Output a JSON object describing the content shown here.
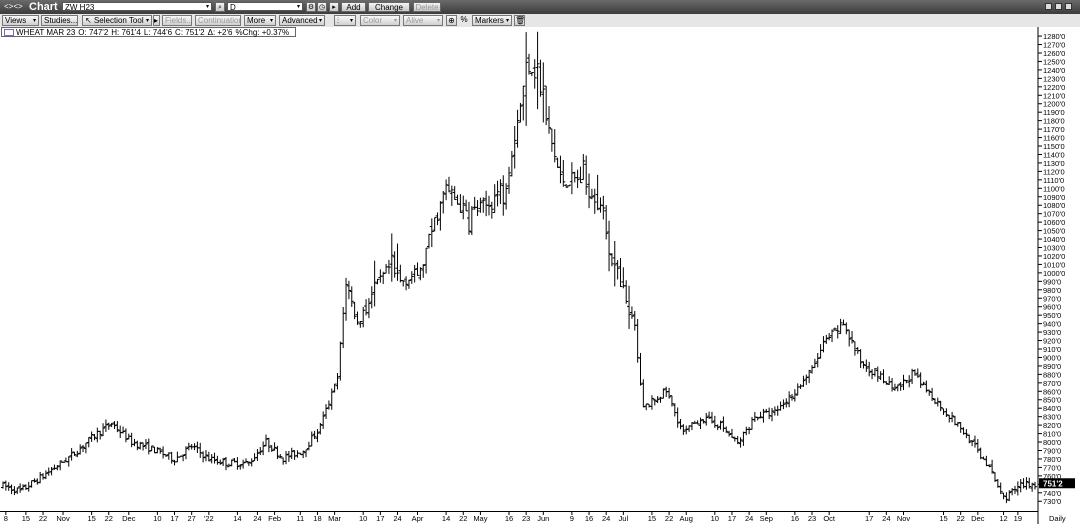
{
  "window": {
    "logo_text": "<><>",
    "title": "Chart",
    "symbol_input": "ZW H23",
    "period_input": "D",
    "add_label": "Add",
    "change_label": "Change",
    "delete_label": "Delete"
  },
  "toolbar": {
    "views": "Views",
    "studies": "Studies...",
    "selection_tool": "Selection Tool",
    "fields": "Fields...",
    "continuation": "Continuation",
    "more": "More",
    "advanced": "Advanced",
    "color": "Color",
    "alive": "Alive",
    "percent": "%",
    "markers": "Markers"
  },
  "legend": {
    "name": "WHEAT MAR 23",
    "open": "O: 747'2",
    "high": "H: 761'4",
    "low": "L: 744'6",
    "close": "C: 751'2",
    "change": "Δ: +2'6",
    "pct": "%Chg: +0.37%"
  },
  "chart_data": {
    "type": "ohlc",
    "ylim": [
      722,
      1286
    ],
    "price_axis_labels": [
      "730'0",
      "740'0",
      "750'0",
      "760'0",
      "770'0",
      "780'0",
      "790'0",
      "800'0",
      "810'0",
      "820'0",
      "830'0",
      "840'0",
      "850'0",
      "860'0",
      "870'0",
      "880'0",
      "890'0",
      "900'0",
      "910'0",
      "920'0",
      "930'0",
      "940'0",
      "950'0",
      "960'0",
      "970'0",
      "980'0",
      "990'0",
      "1000'0",
      "1010'0",
      "1020'0",
      "1030'0",
      "1040'0",
      "1050'0",
      "1060'0",
      "1070'0",
      "1080'0",
      "1090'0",
      "1100'0",
      "1110'0",
      "1120'0",
      "1130'0",
      "1140'0",
      "1150'0",
      "1160'0",
      "1170'0",
      "1180'0",
      "1190'0",
      "1200'0",
      "1210'0",
      "1220'0",
      "1230'0",
      "1240'0",
      "1250'0",
      "1260'0",
      "1270'0",
      "1280'0"
    ],
    "last_price": 751.25,
    "last_price_label": "751'2",
    "period_label": "Daily",
    "x_labels": [
      "8",
      "15",
      "22",
      "Nov",
      "15",
      "22",
      "Dec",
      "10",
      "17",
      "27",
      "'22",
      "14",
      "24",
      "Feb",
      "11",
      "18",
      "Mar",
      "10",
      "17",
      "24",
      "Apr",
      "14",
      "22",
      "May",
      "16",
      "23",
      "Jun",
      "9",
      "16",
      "24",
      "Jul",
      "15",
      "22",
      "Aug",
      "10",
      "17",
      "24",
      "Sep",
      "16",
      "23",
      "Oct",
      "17",
      "24",
      "Nov",
      "15",
      "22",
      "Dec",
      "12",
      "19"
    ],
    "x_label_bars": [
      1,
      8,
      14,
      21,
      31,
      37,
      44,
      54,
      60,
      66,
      72,
      82,
      89,
      95,
      104,
      110,
      116,
      126,
      132,
      138,
      145,
      155,
      161,
      167,
      177,
      183,
      189,
      199,
      205,
      211,
      217,
      227,
      233,
      239,
      249,
      255,
      261,
      267,
      277,
      283,
      289,
      303,
      309,
      315,
      329,
      335,
      341,
      350,
      355
    ],
    "bar_count": 362,
    "key_points": [
      [
        0,
        748
      ],
      [
        6,
        742
      ],
      [
        14,
        760
      ],
      [
        24,
        784
      ],
      [
        32,
        808
      ],
      [
        38,
        822
      ],
      [
        45,
        800
      ],
      [
        52,
        792
      ],
      [
        60,
        780
      ],
      [
        66,
        795
      ],
      [
        72,
        780
      ],
      [
        79,
        775
      ],
      [
        86,
        775
      ],
      [
        92,
        800
      ],
      [
        98,
        781
      ],
      [
        105,
        790
      ],
      [
        111,
        818
      ],
      [
        117,
        875
      ],
      [
        120,
        990
      ],
      [
        124,
        940
      ],
      [
        129,
        975
      ],
      [
        135,
        1005
      ],
      [
        139,
        990
      ],
      [
        146,
        1000
      ],
      [
        150,
        1050
      ],
      [
        155,
        1100
      ],
      [
        162,
        1070
      ],
      [
        170,
        1080
      ],
      [
        176,
        1110
      ],
      [
        181,
        1200
      ],
      [
        184,
        1250
      ],
      [
        187,
        1235
      ],
      [
        190,
        1180
      ],
      [
        195,
        1110
      ],
      [
        202,
        1110
      ],
      [
        209,
        1085
      ],
      [
        214,
        1000
      ],
      [
        221,
        935
      ],
      [
        224,
        840
      ],
      [
        232,
        860
      ],
      [
        238,
        810
      ],
      [
        244,
        828
      ],
      [
        251,
        820
      ],
      [
        257,
        798
      ],
      [
        263,
        830
      ],
      [
        270,
        835
      ],
      [
        277,
        860
      ],
      [
        283,
        885
      ],
      [
        287,
        915
      ],
      [
        294,
        940
      ],
      [
        300,
        895
      ],
      [
        306,
        880
      ],
      [
        312,
        860
      ],
      [
        318,
        880
      ],
      [
        324,
        858
      ],
      [
        330,
        835
      ],
      [
        337,
        808
      ],
      [
        344,
        775
      ],
      [
        350,
        734
      ],
      [
        356,
        748
      ],
      [
        361,
        751
      ]
    ],
    "window_start": "8"
  }
}
